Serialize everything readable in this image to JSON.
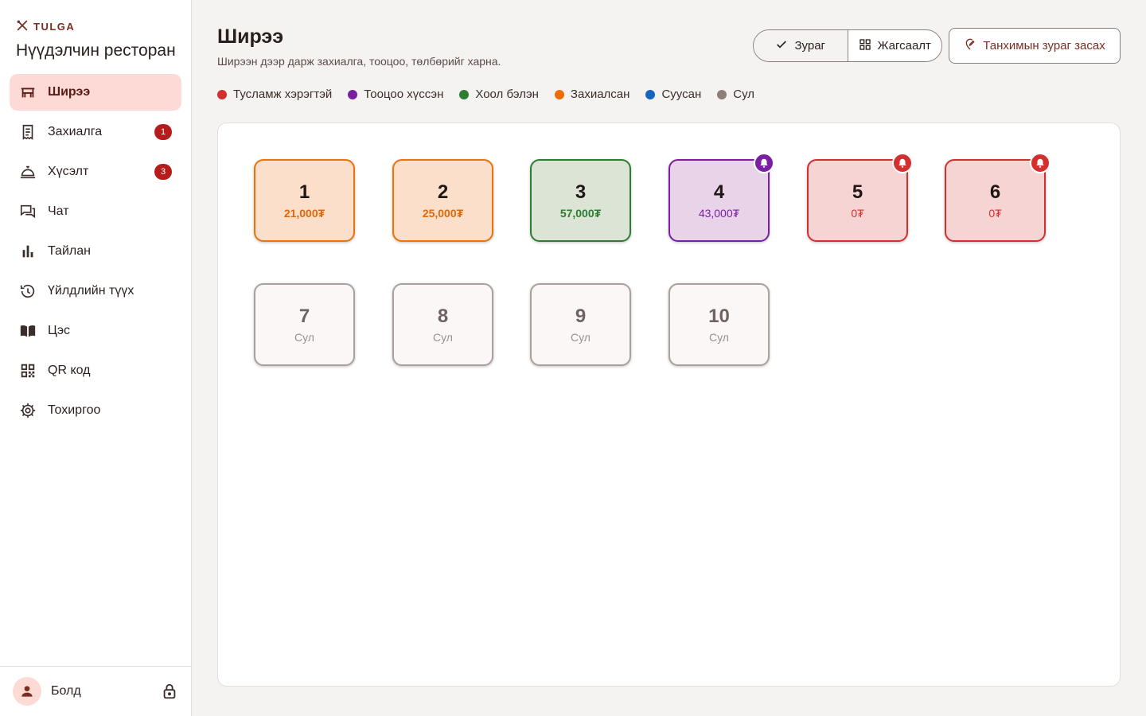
{
  "brand": {
    "name": "TULGA",
    "restaurant": "Нүүдэлчин ресторан"
  },
  "nav": [
    {
      "label": "Ширээ",
      "icon": "table-icon",
      "active": true
    },
    {
      "label": "Захиалга",
      "icon": "receipt-icon",
      "badge": "1"
    },
    {
      "label": "Хүсэлт",
      "icon": "cloche-icon",
      "badge": "3"
    },
    {
      "label": "Чат",
      "icon": "chat-icon"
    },
    {
      "label": "Тайлан",
      "icon": "bar-chart-icon"
    },
    {
      "label": "Үйлдлийн түүх",
      "icon": "history-icon"
    },
    {
      "label": "Цэс",
      "icon": "menu-book-icon"
    },
    {
      "label": "QR код",
      "icon": "qr-code-icon"
    },
    {
      "label": "Тохиргоо",
      "icon": "gear-icon"
    }
  ],
  "user": {
    "name": "Болд"
  },
  "header": {
    "title": "Ширээ",
    "subtitle": "Ширээн дээр дарж захиалга, тооцоо, төлбөрийг харна.",
    "view_map": "Зураг",
    "view_list": "Жагсаалт",
    "edit_map": "Танхимын зураг засах"
  },
  "legend": [
    {
      "label": "Тусламж хэрэгтэй",
      "color": "#d32f2f"
    },
    {
      "label": "Тооцоо хүссэн",
      "color": "#7b1fa2"
    },
    {
      "label": "Хоол бэлэн",
      "color": "#2e7d32"
    },
    {
      "label": "Захиалсан",
      "color": "#ef6c00"
    },
    {
      "label": "Суусан",
      "color": "#1565c0"
    },
    {
      "label": "Сул",
      "color": "#8d7e7a"
    }
  ],
  "tables": [
    {
      "number": "1",
      "amount": "21,000₮",
      "status": "ordered"
    },
    {
      "number": "2",
      "amount": "25,000₮",
      "status": "ordered"
    },
    {
      "number": "3",
      "amount": "57,000₮",
      "status": "ready"
    },
    {
      "number": "4",
      "amount": "43,000₮",
      "status": "bill"
    },
    {
      "number": "5",
      "amount": "0₮",
      "status": "help"
    },
    {
      "number": "6",
      "amount": "0₮",
      "status": "help"
    },
    {
      "number": "7",
      "amount": "Сул",
      "status": "empty"
    },
    {
      "number": "8",
      "amount": "Сул",
      "status": "empty"
    },
    {
      "number": "9",
      "amount": "Сул",
      "status": "empty"
    },
    {
      "number": "10",
      "amount": "Сул",
      "status": "empty"
    }
  ]
}
